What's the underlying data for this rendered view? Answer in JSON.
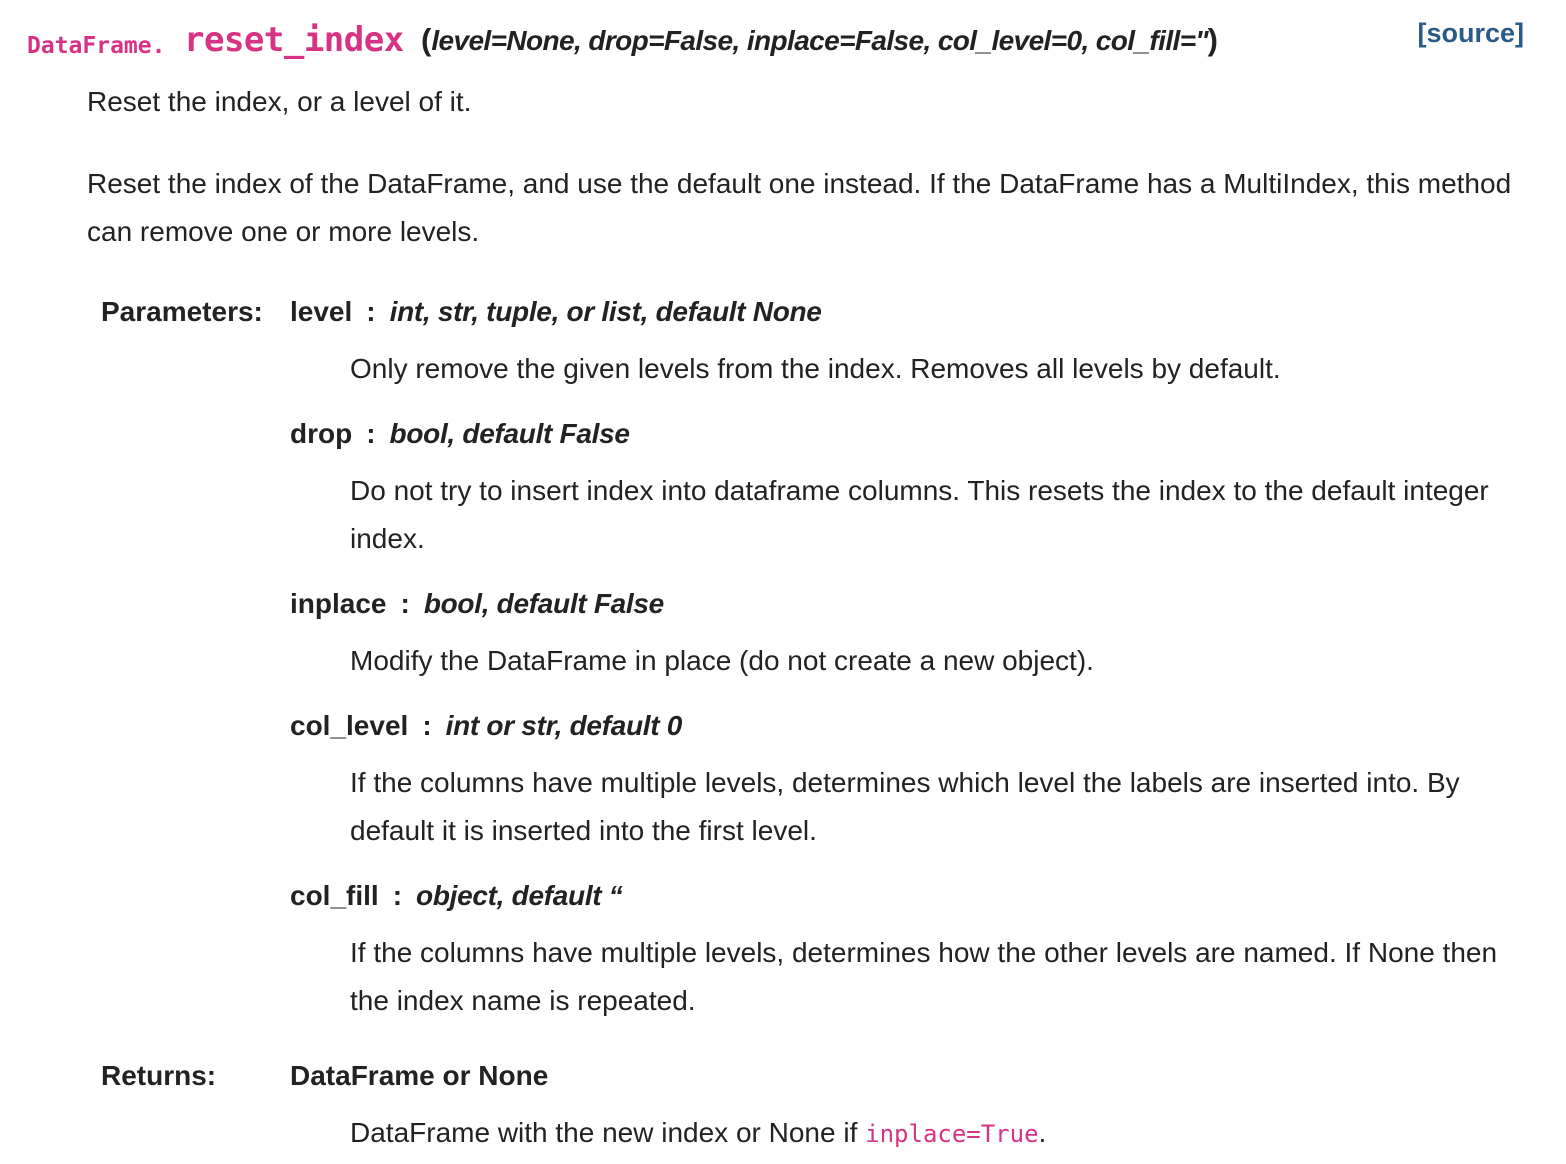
{
  "signature": {
    "prefix": "DataFrame.",
    "name": "reset_index",
    "open_paren": "(",
    "args": "level=None, drop=False, inplace=False, col_level=0, col_fill=''",
    "close_paren": ")"
  },
  "source_link": "[source]",
  "summary": "Reset the index, or a level of it.",
  "description": "Reset the index of the DataFrame, and use the default one instead. If the DataFrame has a MultiIndex, this method can remove one or more levels.",
  "parameters_label": "Parameters:",
  "parameters": [
    {
      "name": "level",
      "type": "int, str, tuple, or list, default None",
      "desc": "Only remove the given levels from the index. Removes all levels by default."
    },
    {
      "name": "drop",
      "type": "bool, default False",
      "desc": "Do not try to insert index into dataframe columns. This resets the index to the default integer index."
    },
    {
      "name": "inplace",
      "type": "bool, default False",
      "desc": "Modify the DataFrame in place (do not create a new object)."
    },
    {
      "name": "col_level",
      "type": "int or str, default 0",
      "desc": "If the columns have multiple levels, determines which level the labels are inserted into. By default it is inserted into the first level."
    },
    {
      "name": "col_fill",
      "type": "object, default “",
      "desc": "If the columns have multiple levels, determines how the other levels are named. If None then the index name is repeated."
    }
  ],
  "returns_label": "Returns:",
  "returns": {
    "type": "DataFrame or None",
    "desc_before": "DataFrame with the new index or None if ",
    "desc_code": "inplace=True",
    "desc_after": "."
  }
}
